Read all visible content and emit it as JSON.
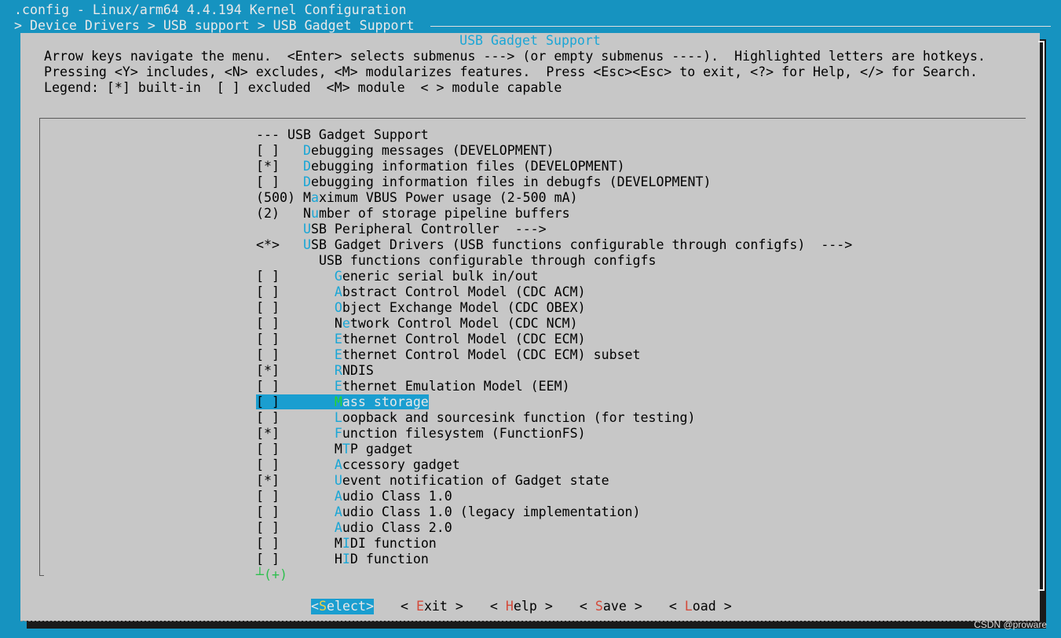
{
  "window": {
    "title": ".config - Linux/arm64 4.4.194 Kernel Configuration",
    "breadcrumb": "> Device Drivers > USB support > USB Gadget Support "
  },
  "dialog": {
    "title": "USB Gadget Support",
    "help_lines": [
      "Arrow keys navigate the menu.  <Enter> selects submenus ---> (or empty submenus ----).  Highlighted letters are hotkeys.",
      "Pressing <Y> includes, <N> excludes, <M> modularizes features.  Press <Esc><Esc> to exit, <?> for Help, </> for Search.",
      "Legend: [*] built-in  [ ] excluded  <M> module  < > module capable"
    ]
  },
  "menu": {
    "items": [
      {
        "prefix": "--- ",
        "hotkey": "",
        "rest": "USB Gadget Support",
        "indent": ""
      },
      {
        "prefix": "[ ]   ",
        "hotkey": "D",
        "rest": "ebugging messages (DEVELOPMENT)",
        "indent": ""
      },
      {
        "prefix": "[*]   ",
        "hotkey": "D",
        "rest": "ebugging information files (DEVELOPMENT)",
        "indent": ""
      },
      {
        "prefix": "[ ]   ",
        "hotkey": "D",
        "rest": "ebugging information files in debugfs (DEVELOPMENT)",
        "indent": ""
      },
      {
        "prefix": "(500) M",
        "hotkey": "a",
        "rest": "ximum VBUS Power usage (2-500 mA)",
        "indent": ""
      },
      {
        "prefix": "(2)   N",
        "hotkey": "u",
        "rest": "mber of storage pipeline buffers",
        "indent": ""
      },
      {
        "prefix": "      ",
        "hotkey": "U",
        "rest": "SB Peripheral Controller  --->",
        "indent": ""
      },
      {
        "prefix": "<*>   ",
        "hotkey": "U",
        "rest": "SB Gadget Drivers (USB functions configurable through configfs)  --->",
        "indent": ""
      },
      {
        "prefix": "        ",
        "hotkey": "",
        "rest": "USB functions configurable through configfs",
        "indent": ""
      },
      {
        "prefix": "[ ]       ",
        "hotkey": "G",
        "rest": "eneric serial bulk in/out",
        "indent": ""
      },
      {
        "prefix": "[ ]       ",
        "hotkey": "A",
        "rest": "bstract Control Model (CDC ACM)",
        "indent": ""
      },
      {
        "prefix": "[ ]       ",
        "hotkey": "O",
        "rest": "bject Exchange Model (CDC OBEX)",
        "indent": ""
      },
      {
        "prefix": "[ ]       N",
        "hotkey": "e",
        "rest": "twork Control Model (CDC NCM)",
        "indent": ""
      },
      {
        "prefix": "[ ]       ",
        "hotkey": "E",
        "rest": "thernet Control Model (CDC ECM)",
        "indent": ""
      },
      {
        "prefix": "[ ]       ",
        "hotkey": "E",
        "rest": "thernet Control Model (CDC ECM) subset",
        "indent": ""
      },
      {
        "prefix": "[*]       ",
        "hotkey": "R",
        "rest": "NDIS",
        "indent": ""
      },
      {
        "prefix": "[ ]       ",
        "hotkey": "E",
        "rest": "thernet Emulation Model (EEM)",
        "indent": ""
      },
      {
        "prefix": "[ ]       ",
        "hotkey": "M",
        "rest": "ass storage",
        "indent": "",
        "selected": true
      },
      {
        "prefix": "[ ]       ",
        "hotkey": "L",
        "rest": "oopback and sourcesink function (for testing)",
        "indent": ""
      },
      {
        "prefix": "[*]       ",
        "hotkey": "F",
        "rest": "unction filesystem (FunctionFS)",
        "indent": ""
      },
      {
        "prefix": "[ ]       M",
        "hotkey": "T",
        "rest": "P gadget",
        "indent": ""
      },
      {
        "prefix": "[ ]       ",
        "hotkey": "A",
        "rest": "ccessory gadget",
        "indent": ""
      },
      {
        "prefix": "[*]       ",
        "hotkey": "U",
        "rest": "event notification of Gadget state",
        "indent": ""
      },
      {
        "prefix": "[ ]       ",
        "hotkey": "A",
        "rest": "udio Class 1.0",
        "indent": ""
      },
      {
        "prefix": "[ ]       ",
        "hotkey": "A",
        "rest": "udio Class 1.0 (legacy implementation)",
        "indent": ""
      },
      {
        "prefix": "[ ]       ",
        "hotkey": "A",
        "rest": "udio Class 2.0",
        "indent": ""
      },
      {
        "prefix": "[ ]       M",
        "hotkey": "I",
        "rest": "DI function",
        "indent": ""
      },
      {
        "prefix": "[ ]       H",
        "hotkey": "I",
        "rest": "D function",
        "indent": ""
      }
    ],
    "more_indicator": "┴(+)"
  },
  "buttons": [
    {
      "name": "select",
      "before": "<",
      "hotkey": "S",
      "rest": "elect",
      "after": ">",
      "active": true
    },
    {
      "name": "exit",
      "before": "< ",
      "hotkey": "E",
      "rest": "xit",
      "after": " >",
      "active": false
    },
    {
      "name": "help",
      "before": "< ",
      "hotkey": "H",
      "rest": "elp",
      "after": " >",
      "active": false
    },
    {
      "name": "save",
      "before": "< ",
      "hotkey": "S",
      "rest": "ave",
      "after": " >",
      "active": false
    },
    {
      "name": "load",
      "before": "< ",
      "hotkey": "L",
      "rest": "oad",
      "after": " >",
      "active": false
    }
  ],
  "watermark": "CSDN @proware",
  "colors": {
    "terminal_bg": "#1693c0",
    "dialog_bg": "#c7c7c7",
    "hotkey": "#1aa6d6",
    "button_hotkey": "#d44a3a",
    "selection": "#1a9ed0"
  }
}
